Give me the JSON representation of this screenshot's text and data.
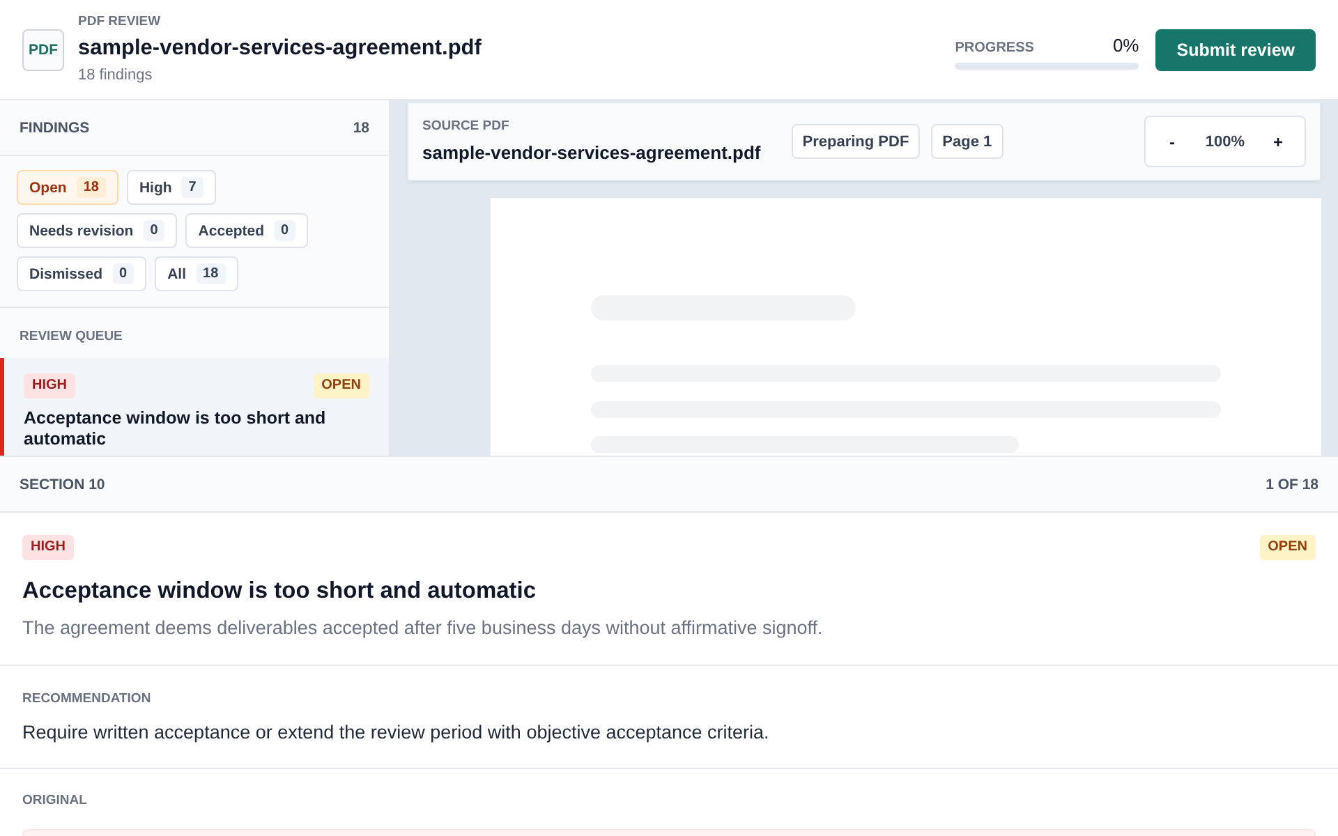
{
  "header": {
    "eyebrow": "PDF REVIEW",
    "file_type": "PDF",
    "title": "sample-vendor-services-agreement.pdf",
    "subtitle": "18 findings",
    "progress": {
      "label": "PROGRESS",
      "value": "0%",
      "level": 0
    },
    "submit_button": "Submit review"
  },
  "sidebar": {
    "title": "FINDINGS",
    "count": "18",
    "filters": [
      {
        "label": "Open",
        "count": "18",
        "selected": true
      },
      {
        "label": "High",
        "count": "7",
        "selected": false
      },
      {
        "label": "Needs revision",
        "count": "0",
        "selected": false
      },
      {
        "label": "Accepted",
        "count": "0",
        "selected": false
      },
      {
        "label": "Dismissed",
        "count": "0",
        "selected": false
      },
      {
        "label": "All",
        "count": "18",
        "selected": false
      }
    ],
    "queue_title": "REVIEW QUEUE",
    "queue": [
      {
        "badges": [
          {
            "kind": "severity",
            "label": "HIGH"
          },
          {
            "kind": "status",
            "label": "OPEN"
          }
        ],
        "title": "Acceptance window is too short and automatic",
        "selected": true
      }
    ]
  },
  "viewer": {
    "eyebrow": "SOURCE PDF",
    "file_name": "sample-vendor-services-agreement.pdf",
    "chips": [
      "Preparing PDF",
      "Page 1"
    ],
    "zoom": {
      "minus": "-",
      "value": "100%",
      "plus": "+"
    }
  },
  "detail": {
    "section": "SECTION 10",
    "position": "1 OF 18",
    "badges": [
      {
        "kind": "severity",
        "label": "HIGH"
      },
      {
        "kind": "status",
        "label": "OPEN"
      }
    ],
    "title": "Acceptance window is too short and automatic",
    "description": "The agreement deems deliverables accepted after five business days without affirmative signoff.",
    "blocks": [
      {
        "kind": "text",
        "label": "RECOMMENDATION",
        "text": "Require written acceptance or extend the review period with objective acceptance criteria."
      },
      {
        "kind": "quote",
        "label": "ORIGINAL"
      }
    ]
  }
}
